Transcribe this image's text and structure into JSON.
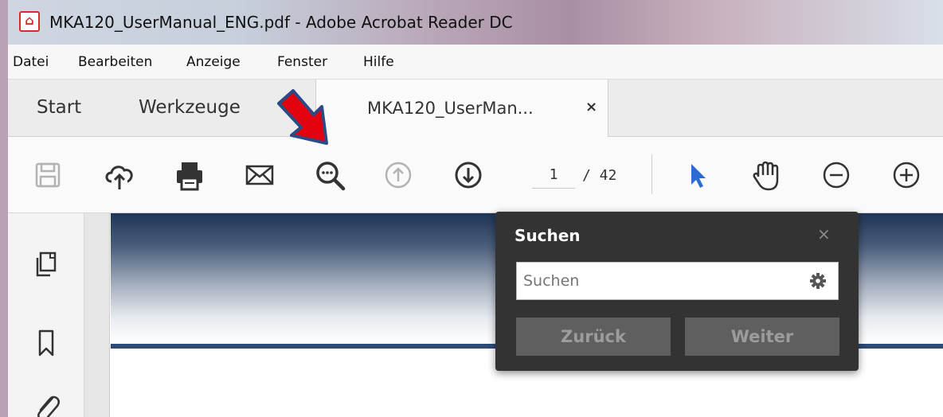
{
  "window": {
    "title": "MKA120_UserManual_ENG.pdf - Adobe Acrobat Reader DC",
    "app_icon": "acrobat-reader-icon"
  },
  "menubar": {
    "items": [
      "Datei",
      "Bearbeiten",
      "Anzeige",
      "Fenster",
      "Hilfe"
    ]
  },
  "tabs": {
    "start_label": "Start",
    "tools_label": "Werkzeuge",
    "document_label": "MKA120_UserMan...",
    "document_close": "×"
  },
  "toolbar": {
    "icons": [
      "save-icon",
      "cloud-upload-icon",
      "print-icon",
      "email-icon",
      "find-icon",
      "page-up-icon",
      "page-down-icon",
      "select-arrow-icon",
      "hand-tool-icon",
      "zoom-out-icon",
      "zoom-in-icon"
    ],
    "current_page": "1",
    "page_total": "/ 42"
  },
  "sidebar": {
    "icons": [
      "page-thumbnails-icon",
      "bookmark-icon",
      "attachment-icon"
    ]
  },
  "search": {
    "title": "Suchen",
    "close": "×",
    "placeholder": "Suchen",
    "back_label": "Zurück",
    "next_label": "Weiter"
  },
  "colors": {
    "accent_blue": "#2b6cd4",
    "annotation_arrow": "#e3000f",
    "popup_bg": "#333333"
  }
}
